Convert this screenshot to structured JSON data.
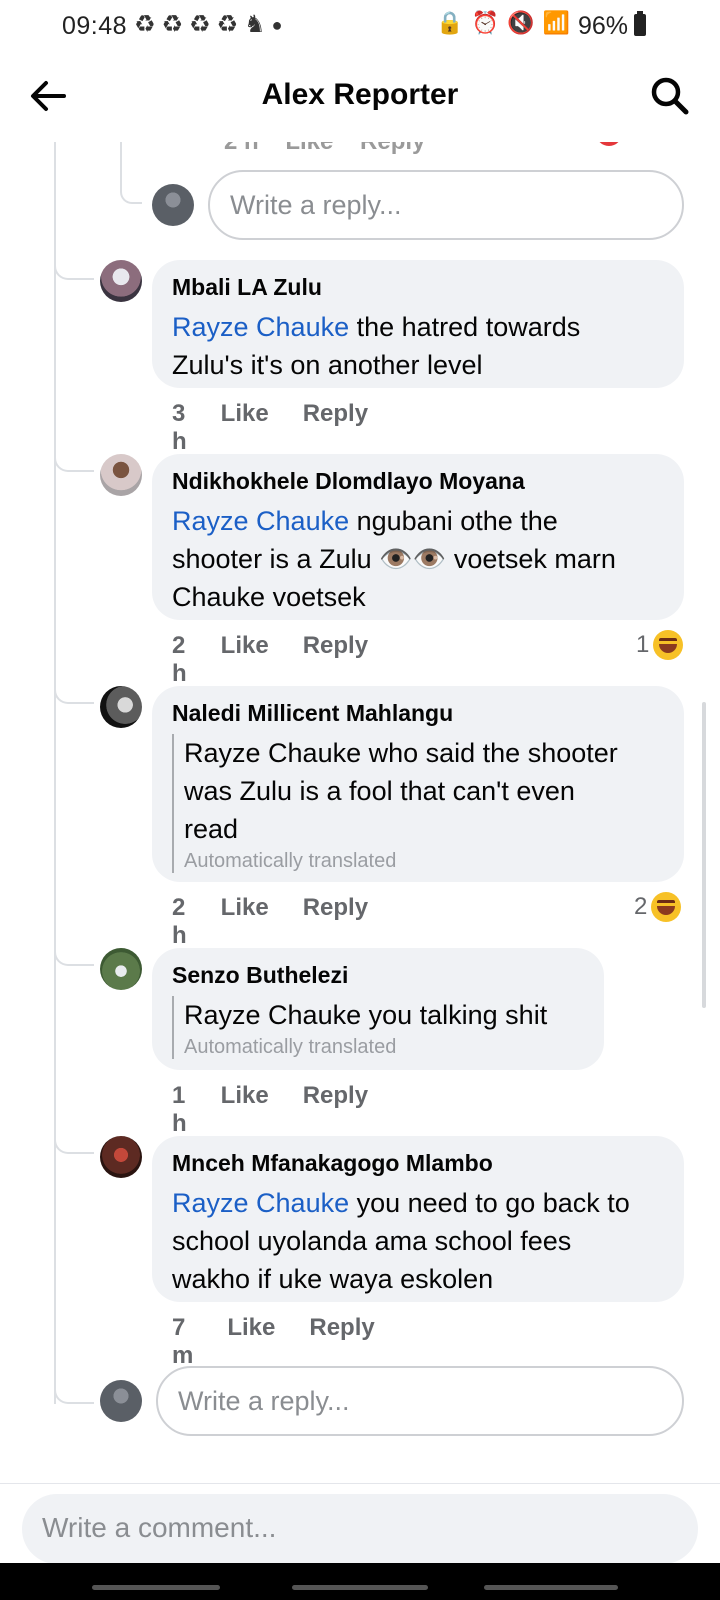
{
  "status_bar": {
    "time": "09:48",
    "notification_icons": [
      "loop-icon",
      "loop-icon",
      "loop-icon",
      "loop-icon",
      "figure-icon",
      "dot-icon"
    ],
    "battery": "96%"
  },
  "header": {
    "title": "Alex Reporter"
  },
  "thread": {
    "reply_placeholder_top": "Write a reply...",
    "comments": [
      {
        "author": "Mbali LA Zulu",
        "mention": "Rayze Chauke",
        "text_line1": " the hatred towards",
        "text_line2": "Zulu's it's on another level",
        "time": "3 h",
        "like": "Like",
        "reply": "Reply"
      },
      {
        "author": "Ndikhokhele Dlomdlayo Moyana",
        "mention": "Rayze Chauke",
        "text_line1": " ngubani othe the",
        "text_line2": "shooter is a Zulu 👁️👁️ voetsek marn",
        "text_line3": "Chauke voetsek",
        "time": "2 h",
        "like": "Like",
        "reply": "Reply",
        "reaction_count": "1"
      },
      {
        "author": "Naledi Millicent Mahlangu",
        "text_line1": "Rayze Chauke who said the shooter",
        "text_line2": "was Zulu is a fool that can't even",
        "text_line3": "read",
        "translated_note": "Automatically translated",
        "time": "2 h",
        "like": "Like",
        "reply": "Reply",
        "reaction_count": "2"
      },
      {
        "author": "Senzo Buthelezi",
        "text_line1": "Rayze Chauke you talking shit",
        "translated_note": "Automatically translated",
        "time": "1 h",
        "like": "Like",
        "reply": "Reply"
      },
      {
        "author": "Mnceh Mfanakagogo Mlambo",
        "mention": "Rayze Chauke",
        "text_line1": " you need to go back to",
        "text_line2": "school uyolanda ama school fees",
        "text_line3": "wakho if uke waya eskolen",
        "time": "7 m",
        "like": "Like",
        "reply": "Reply"
      }
    ],
    "reply_placeholder_bottom": "Write a reply..."
  },
  "composer": {
    "placeholder": "Write a comment..."
  },
  "colors": {
    "mention": "#1b5fc6",
    "bubble": "#f0f2f5",
    "meta": "#65676b"
  }
}
